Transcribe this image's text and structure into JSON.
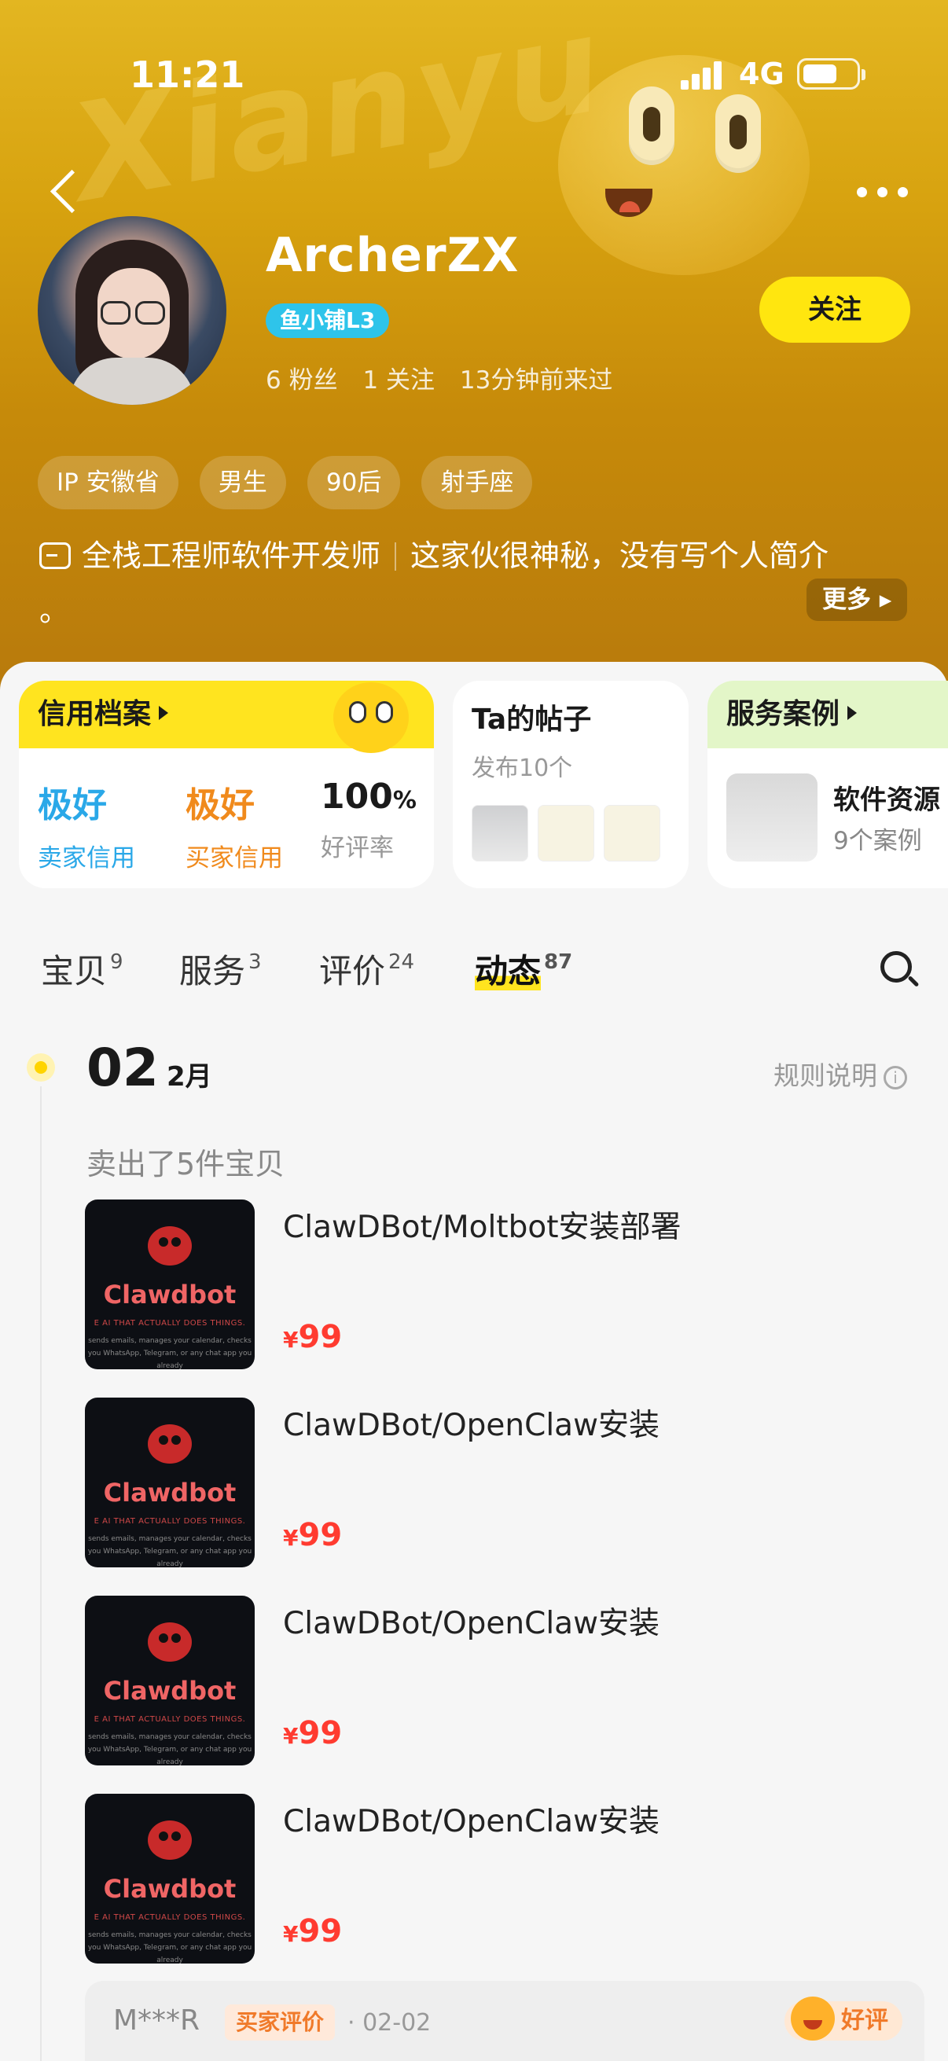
{
  "status_bar": {
    "time": "11:21",
    "network": "4G"
  },
  "profile": {
    "name": "ArcherZX",
    "level_badge": "鱼小铺L3",
    "followers": "6 粉丝",
    "following": "1 关注",
    "last_seen": "13分钟前来过",
    "follow_label": "关注",
    "watermark": "Xianyu",
    "tags": [
      "IP 安徽省",
      "男生",
      "90后",
      "射手座"
    ],
    "bio_title": "全栈工程师软件开发师",
    "bio_text": "这家伙很神秘，没有写个人简介",
    "bio_tail": "。",
    "bio_more": "更多"
  },
  "cards": {
    "credit": {
      "title": "信用档案",
      "seller_value": "极好",
      "seller_label": "卖家信用",
      "buyer_value": "极好",
      "buyer_label": "买家信用",
      "rate_value": "100",
      "rate_unit": "%",
      "rate_label": "好评率"
    },
    "posts": {
      "title": "Ta的帖子",
      "subtitle": "发布10个"
    },
    "cases": {
      "title": "服务案例",
      "item_title": "软件资源",
      "item_sub": "9个案例"
    }
  },
  "tabs": [
    {
      "label": "宝贝",
      "count": "9"
    },
    {
      "label": "服务",
      "count": "3"
    },
    {
      "label": "评价",
      "count": "24"
    },
    {
      "label": "动态",
      "count": "87"
    }
  ],
  "feed": {
    "day": "02",
    "month": "2月",
    "rules_label": "规则说明",
    "sold_text": "卖出了5件宝贝",
    "image_brand": "Clawdbot",
    "image_tagline": "E AI THAT ACTUALLY DOES THINGS.",
    "image_caption": "sends emails, manages your calendar, checks you WhatsApp, Telegram, or any chat app you already",
    "items": [
      {
        "title": "ClawDBot/Moltbot安装部署",
        "currency": "¥",
        "price": "99"
      },
      {
        "title": "ClawDBot/OpenClaw安装",
        "currency": "¥",
        "price": "99"
      },
      {
        "title": "ClawDBot/OpenClaw安装",
        "currency": "¥",
        "price": "99"
      },
      {
        "title": "ClawDBot/OpenClaw安装",
        "currency": "¥",
        "price": "99"
      }
    ],
    "review": {
      "user": "M***R",
      "badge": "买家评价",
      "date": "· 02-02",
      "rating": "好评"
    }
  }
}
